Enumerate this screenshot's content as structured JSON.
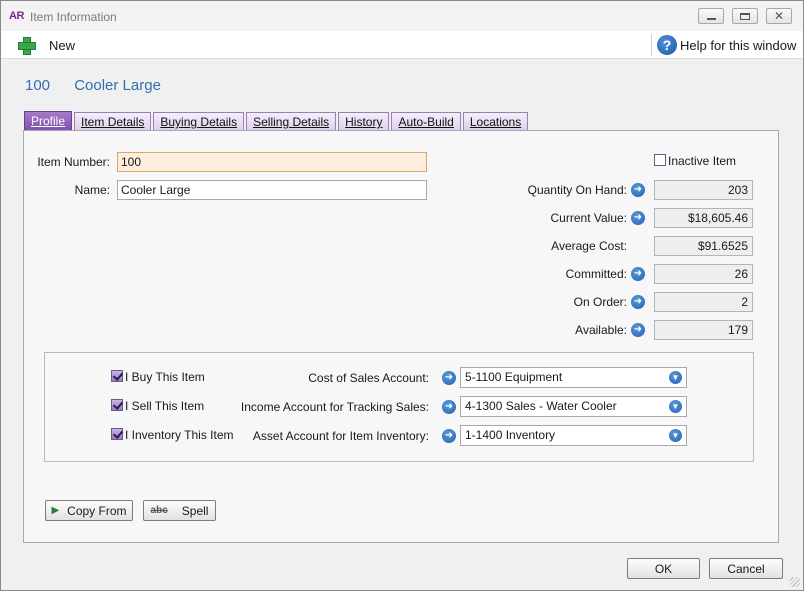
{
  "window": {
    "app_logo": "AR",
    "title": "Item Information",
    "minimize_glyph": "",
    "maximize_glyph": "",
    "close_glyph": "✕"
  },
  "toolbar": {
    "new_label": "New",
    "new_icon": "plus-icon",
    "help_label": "Help for this window",
    "help_icon_glyph": "?"
  },
  "item": {
    "number": "100",
    "name": "Cooler Large"
  },
  "tabs": [
    {
      "label": "Profile",
      "active": true
    },
    {
      "label": "Item Details",
      "active": false
    },
    {
      "label": "Buying Details",
      "active": false
    },
    {
      "label": "Selling Details",
      "active": false
    },
    {
      "label": "History",
      "active": false
    },
    {
      "label": "Auto-Build",
      "active": false
    },
    {
      "label": "Locations",
      "active": false
    }
  ],
  "profile": {
    "item_number_label": "Item Number:",
    "item_number_value": "100",
    "name_label": "Name:",
    "name_value": "Cooler Large",
    "inactive_label": "Inactive Item",
    "inactive_checked": false
  },
  "stats": [
    {
      "label": "Quantity On Hand:",
      "value": "203",
      "has_link": true
    },
    {
      "label": "Current Value:",
      "value": "$18,605.46",
      "has_link": true
    },
    {
      "label": "Average Cost:",
      "value": "$91.6525",
      "has_link": false
    },
    {
      "label": "Committed:",
      "value": "26",
      "has_link": true
    },
    {
      "label": "On Order:",
      "value": "2",
      "has_link": true
    },
    {
      "label": "Available:",
      "value": "179",
      "has_link": true
    }
  ],
  "accounts": [
    {
      "check_label": "I Buy This Item",
      "checked": true,
      "account_label": "Cost of Sales Account:",
      "account_value": "5-1100 Equipment"
    },
    {
      "check_label": "I Sell This Item",
      "checked": true,
      "account_label": "Income Account for Tracking Sales:",
      "account_value": "4-1300 Sales - Water Cooler"
    },
    {
      "check_label": "I Inventory This Item",
      "checked": true,
      "account_label": "Asset Account for Item Inventory:",
      "account_value": "1-1400 Inventory"
    }
  ],
  "buttons": {
    "copy_from": "Copy From",
    "spell": "Spell",
    "spell_icon_text": "abc",
    "ok": "OK",
    "cancel": "Cancel"
  },
  "glyphs": {
    "arrow": "➜",
    "dropdown": "▼"
  },
  "colors": {
    "accent_blue": "#2f6fb2",
    "tab_active": "#7e4fb0",
    "highlight_input": "#fdeedd"
  }
}
